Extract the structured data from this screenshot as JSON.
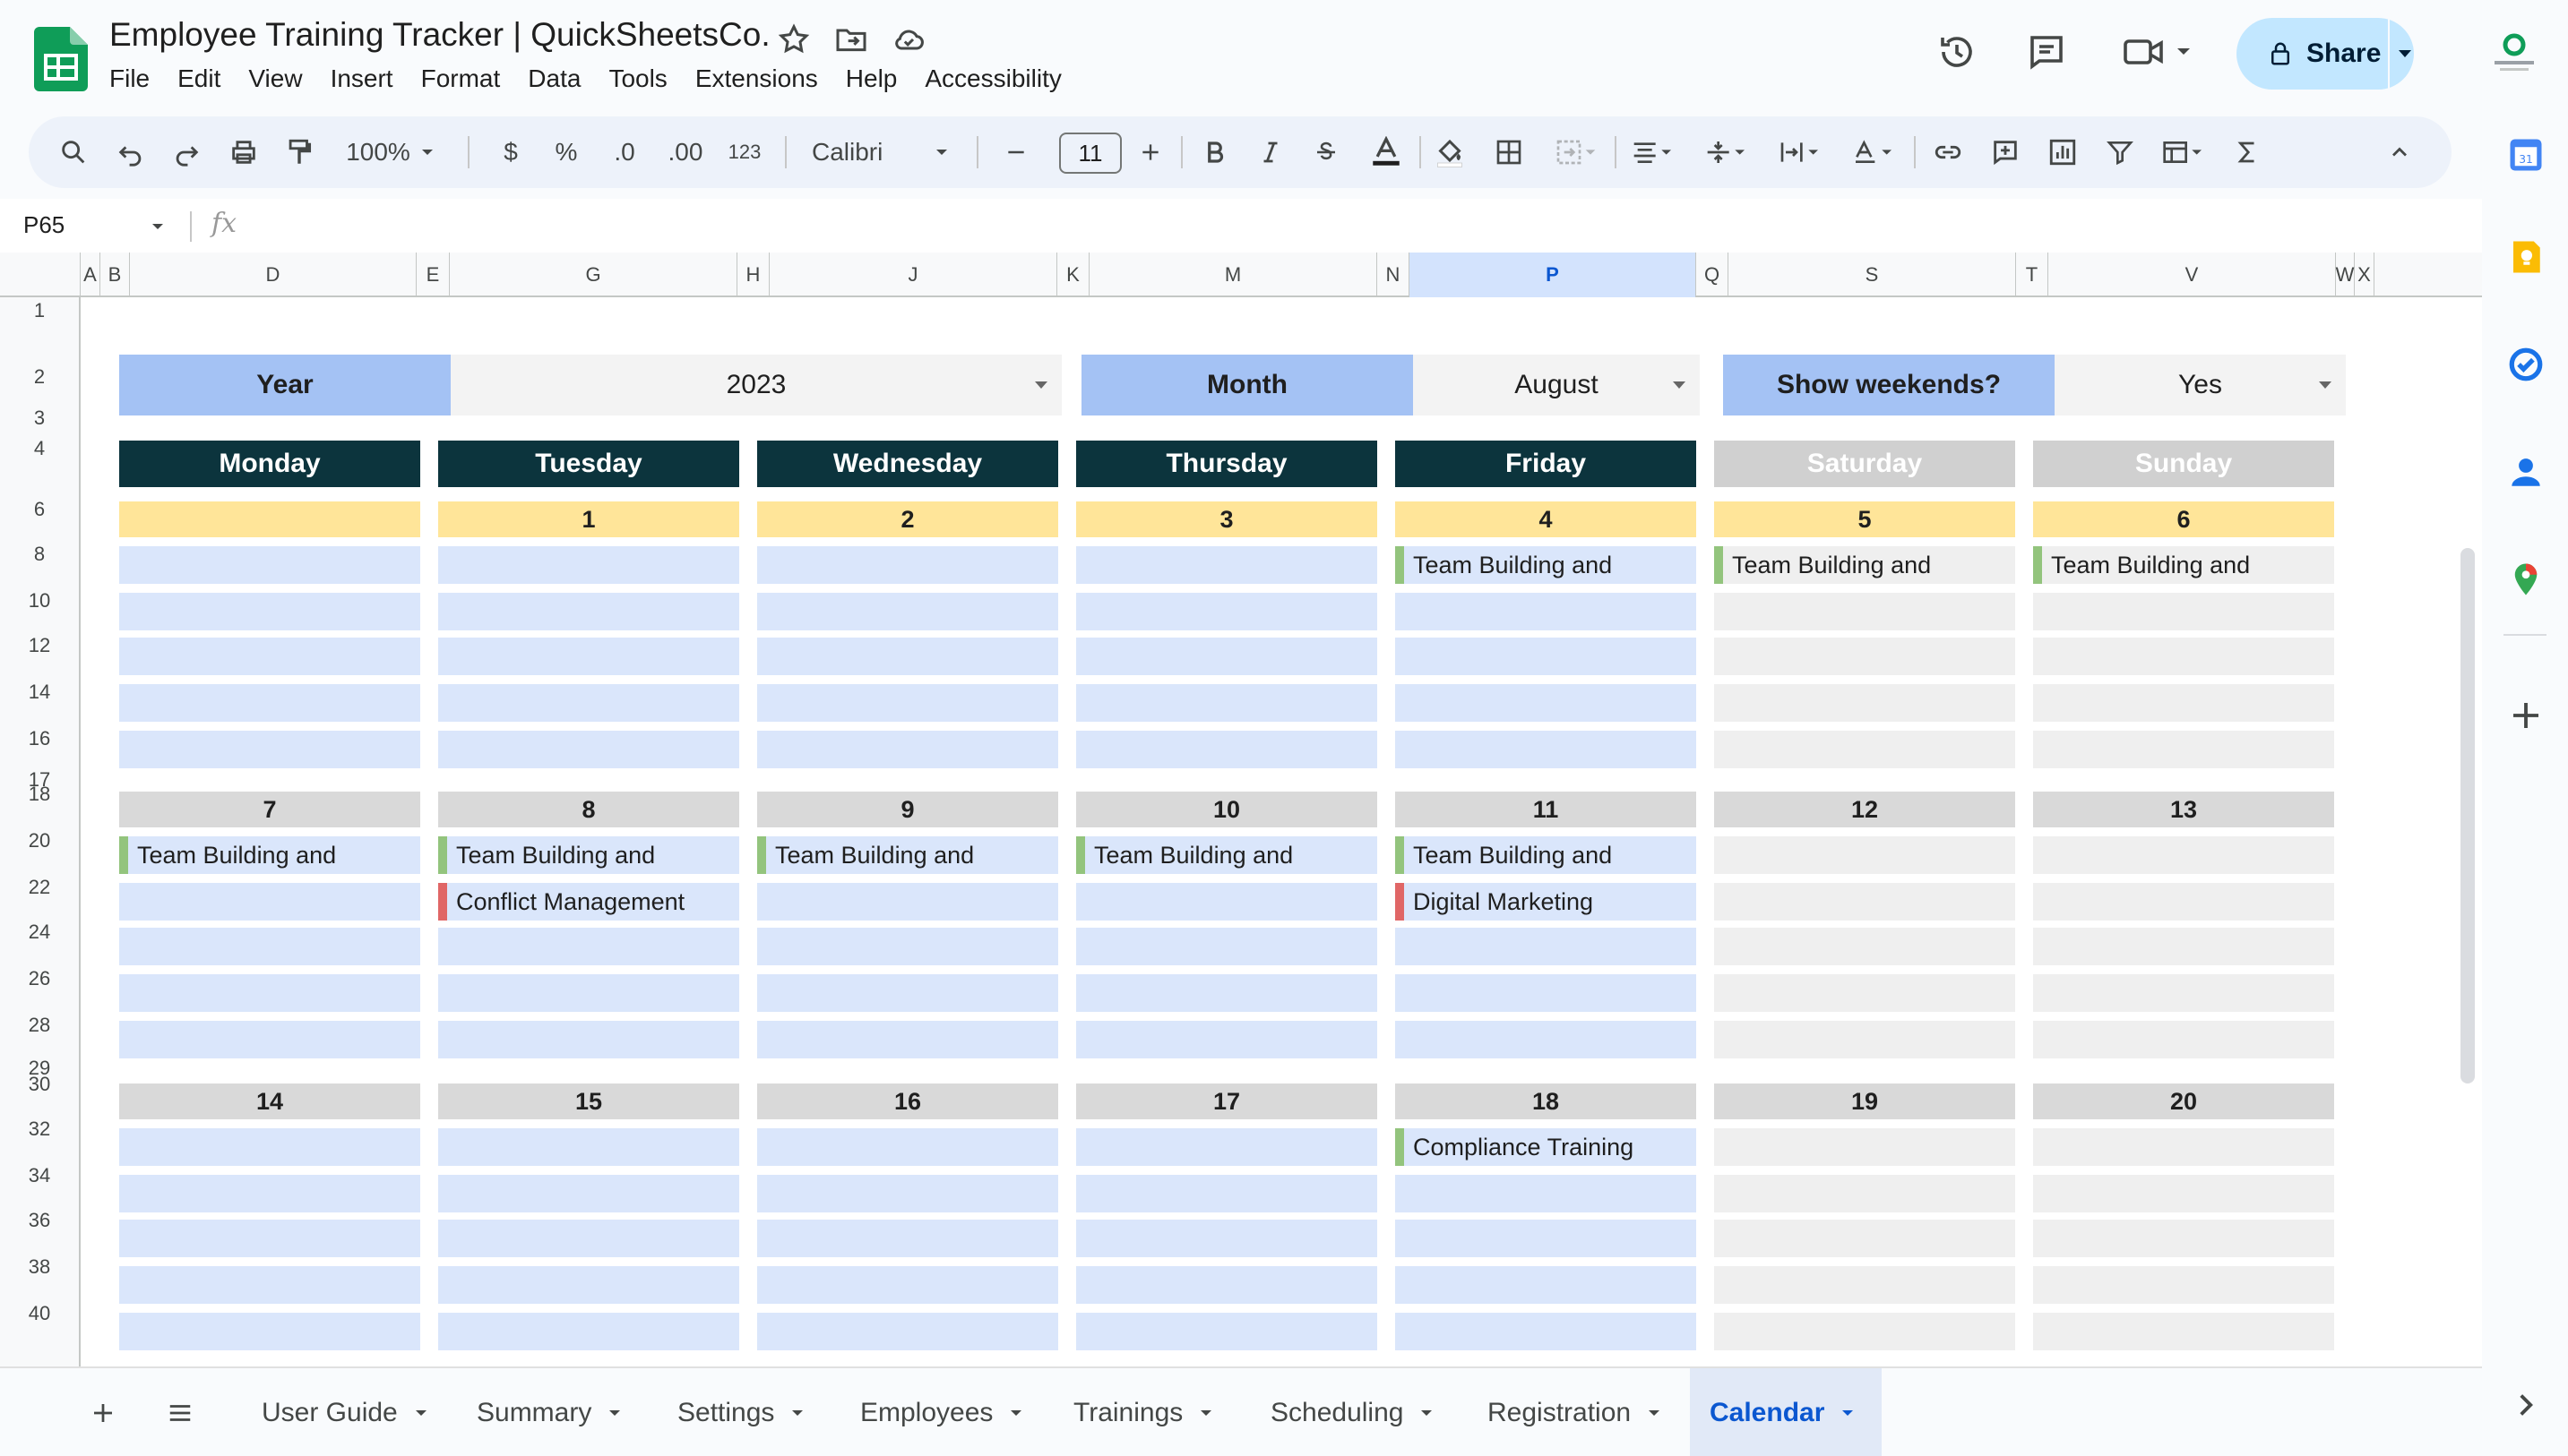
{
  "app": {
    "title": "Employee Training Tracker | QuickSheetsCo.",
    "menu": [
      "File",
      "Edit",
      "View",
      "Insert",
      "Format",
      "Data",
      "Tools",
      "Extensions",
      "Help",
      "Accessibility"
    ],
    "share_label": "Share",
    "accent": "#c2e7ff",
    "icons": [
      "star-icon",
      "move-folder-icon",
      "cloud-status-icon",
      "history-icon",
      "comments-icon",
      "meet-icon"
    ]
  },
  "toolbar": {
    "zoom": "100%",
    "currency": "$",
    "percent": "%",
    "decrease_decimals": ".0",
    "increase_decimals": ".00",
    "number_format": "123",
    "font": "Calibri",
    "font_size": "11"
  },
  "formula_bar": {
    "name_box": "P65",
    "fx": "fx",
    "value": ""
  },
  "columns": [
    {
      "id": "A",
      "label": "A"
    },
    {
      "id": "B",
      "label": "B"
    },
    {
      "id": "D",
      "label": "D"
    },
    {
      "id": "E",
      "label": "E"
    },
    {
      "id": "G",
      "label": "G"
    },
    {
      "id": "H",
      "label": "H"
    },
    {
      "id": "J",
      "label": "J"
    },
    {
      "id": "K",
      "label": "K"
    },
    {
      "id": "M",
      "label": "M"
    },
    {
      "id": "N",
      "label": "N"
    },
    {
      "id": "P",
      "label": "P",
      "selected": true
    },
    {
      "id": "Q",
      "label": "Q"
    },
    {
      "id": "S",
      "label": "S"
    },
    {
      "id": "T",
      "label": "T"
    },
    {
      "id": "V",
      "label": "V"
    },
    {
      "id": "W",
      "label": "W"
    },
    {
      "id": "X",
      "label": "X"
    }
  ],
  "rows": [
    "1",
    "2",
    "3",
    "4",
    "6",
    "8",
    "10",
    "12",
    "14",
    "16",
    "17",
    "18",
    "20",
    "22",
    "24",
    "26",
    "28",
    "29",
    "30",
    "32",
    "34",
    "36",
    "38",
    "40"
  ],
  "controls": {
    "year_label": "Year",
    "year_value": "2023",
    "month_label": "Month",
    "month_value": "August",
    "weekends_label": "Show weekends?",
    "weekends_value": "Yes"
  },
  "days": [
    "Monday",
    "Tuesday",
    "Wednesday",
    "Thursday",
    "Friday",
    "Saturday",
    "Sunday"
  ],
  "weeks": [
    {
      "dates": [
        "",
        "1",
        "2",
        "3",
        "4",
        "5",
        "6"
      ],
      "highlight": true,
      "events": [
        [],
        [],
        [],
        [],
        [
          {
            "text": "Team Building and",
            "color": "#93c47d"
          }
        ],
        [
          {
            "text": "Team Building and",
            "color": "#93c47d"
          }
        ],
        [
          {
            "text": "Team Building and",
            "color": "#93c47d"
          }
        ]
      ]
    },
    {
      "dates": [
        "7",
        "8",
        "9",
        "10",
        "11",
        "12",
        "13"
      ],
      "highlight": false,
      "events": [
        [
          {
            "text": "Team Building and",
            "color": "#93c47d"
          }
        ],
        [
          {
            "text": "Team Building and",
            "color": "#93c47d"
          },
          {
            "text": "Conflict Management",
            "color": "#e06666"
          }
        ],
        [
          {
            "text": "Team Building and",
            "color": "#93c47d"
          }
        ],
        [
          {
            "text": "Team Building and",
            "color": "#93c47d"
          }
        ],
        [
          {
            "text": "Team Building and",
            "color": "#93c47d"
          },
          {
            "text": "Digital Marketing",
            "color": "#e06666"
          }
        ],
        [],
        []
      ]
    },
    {
      "dates": [
        "14",
        "15",
        "16",
        "17",
        "18",
        "19",
        "20"
      ],
      "highlight": false,
      "events": [
        [],
        [],
        [],
        [],
        [
          {
            "text": "Compliance Training",
            "color": "#93c47d"
          }
        ],
        [],
        []
      ]
    }
  ],
  "tabs": [
    "User Guide",
    "Summary",
    "Settings",
    "Employees",
    "Trainings",
    "Scheduling",
    "Registration",
    "Calendar"
  ],
  "active_tab": "Calendar"
}
